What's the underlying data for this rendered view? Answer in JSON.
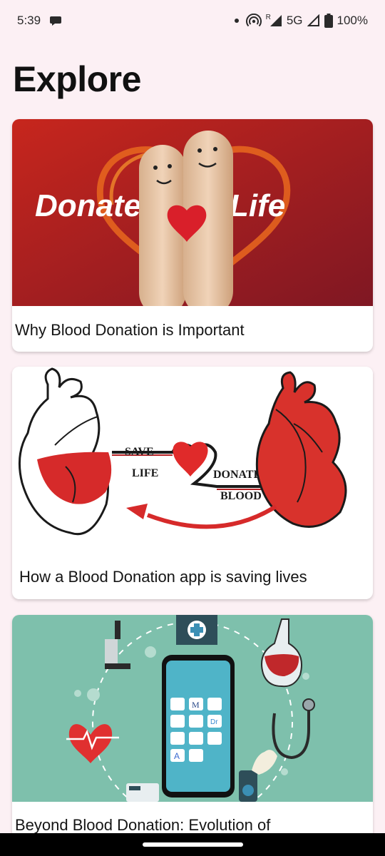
{
  "status_bar": {
    "time": "5:39",
    "network": "5G",
    "roaming": "R",
    "battery": "100%",
    "icons": [
      "chat-bubble-icon",
      "dot-icon",
      "hotspot-icon",
      "signal-icon",
      "battery-icon"
    ]
  },
  "page": {
    "title": "Explore"
  },
  "cards": [
    {
      "title": "Why Blood Donation is Important",
      "image_text": {
        "left": "Donate",
        "right": "Life"
      }
    },
    {
      "title": "How a Blood Donation app is saving lives",
      "image_text": {
        "save": "SAVE",
        "life": "LIFE",
        "donate": "DONATE",
        "blood": "BLOOD"
      }
    },
    {
      "title": "Beyond Blood Donation: Evolution of",
      "image_text": {
        "app_m": "M",
        "app_dr": "Dr",
        "app_a": "A"
      }
    }
  ],
  "colors": {
    "background": "#fcf0f4",
    "card": "#ffffff",
    "blood_red": "#c0282b",
    "teal": "#7ec0ac"
  }
}
